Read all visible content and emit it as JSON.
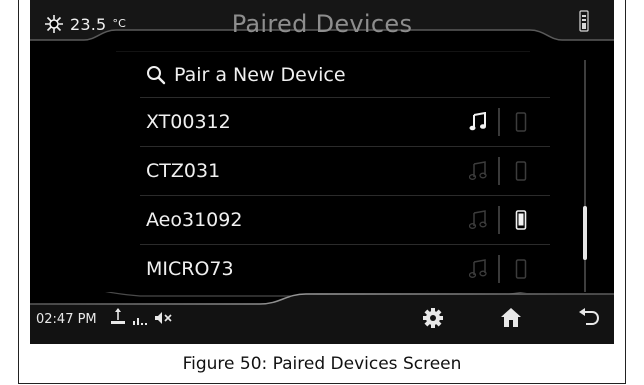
{
  "header": {
    "temperature": "23.5",
    "temperature_unit": "°C",
    "title": "Paired Devices",
    "icons": {
      "climate": "snowflake-sun-icon",
      "phone_status": "phone-battery-icon"
    }
  },
  "list": {
    "pair_label": "Pair a New Device",
    "devices": [
      {
        "name": "XT00312",
        "music_active": true,
        "phone_active": false
      },
      {
        "name": "CTZ031",
        "music_active": false,
        "phone_active": false
      },
      {
        "name": "Aeo31092",
        "music_active": false,
        "phone_active": true
      },
      {
        "name": "MICRO73",
        "music_active": false,
        "phone_active": false
      }
    ]
  },
  "status": {
    "time": "02:47 PM",
    "icons": [
      "usb-icon",
      "signal-icon",
      "mute-icon"
    ]
  },
  "nav": {
    "icons": [
      "settings-gear-icon",
      "home-icon",
      "back-icon"
    ]
  },
  "colors": {
    "active_icon": "#f2f2f2",
    "inactive_icon": "#3c3c3c",
    "title": "#8e8e8e"
  },
  "caption": "Figure 50: Paired Devices Screen"
}
